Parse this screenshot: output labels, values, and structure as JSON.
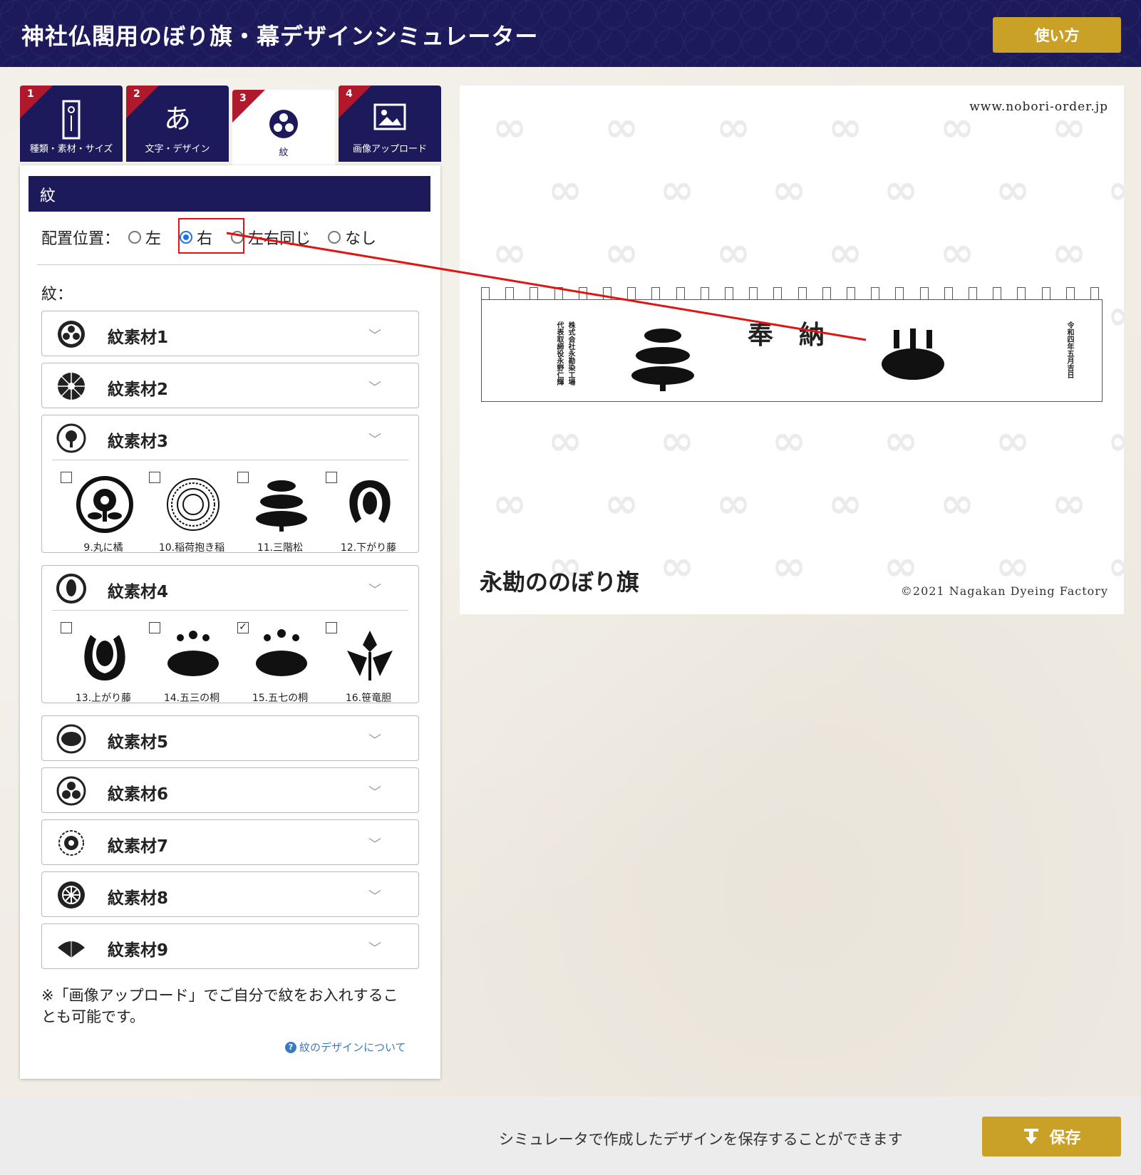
{
  "header": {
    "title": "神社仏閣用のぼり旗・幕デザインシミュレーター",
    "help_label": "使い方"
  },
  "tabs": [
    {
      "num": "1",
      "label": "種類・素材・サイズ"
    },
    {
      "num": "2",
      "label": "文字・デザイン",
      "glyph": "あ"
    },
    {
      "num": "3",
      "label": "紋"
    },
    {
      "num": "4",
      "label": "画像アップロード"
    }
  ],
  "panel": {
    "title": "紋",
    "placement_label": "配置位置：",
    "placement_options": [
      "左",
      "右",
      "左右同じ",
      "なし"
    ],
    "placement_selected": "右",
    "mon_label": "紋：",
    "chevron": "﹀",
    "categories": [
      {
        "title": "紋素材1"
      },
      {
        "title": "紋素材2"
      },
      {
        "title": "紋素材3",
        "items": [
          {
            "label": "9.丸に橘",
            "checked": false
          },
          {
            "label": "10.稲荷抱き稲",
            "checked": false
          },
          {
            "label": "11.三階松",
            "checked": false
          },
          {
            "label": "12.下がり藤",
            "checked": false
          }
        ]
      },
      {
        "title": "紋素材4",
        "items": [
          {
            "label": "13.上がり藤",
            "checked": false
          },
          {
            "label": "14.五三の桐",
            "checked": false
          },
          {
            "label": "15.五七の桐",
            "checked": true
          },
          {
            "label": "16.笹竜胆",
            "checked": false
          }
        ]
      },
      {
        "title": "紋素材5"
      },
      {
        "title": "紋素材6"
      },
      {
        "title": "紋素材7"
      },
      {
        "title": "紋素材8"
      },
      {
        "title": "紋素材9"
      }
    ],
    "note": "※「画像アップロード」でご自分で紋をお入れすることも可能です。",
    "link_label": "紋のデザインについて"
  },
  "preview": {
    "url": "www.nobori-order.jp",
    "banner_text": "奉　納",
    "left_vertical_1": "株式会社永勘染工場",
    "left_vertical_2": "代表取締役永野仁輝",
    "right_vertical": "令和四年五月吉日",
    "brand": "永勘ののぼり旗",
    "copyright": "©2021 Nagakan Dyeing Factory"
  },
  "footer": {
    "text": "シミュレータで作成したデザインを保存することができます",
    "save_label": "保存"
  },
  "colors": {
    "navy": "#1d1a5c",
    "gold": "#c8a126",
    "tab_corner": "#b0182c",
    "highlight": "#e01414"
  }
}
